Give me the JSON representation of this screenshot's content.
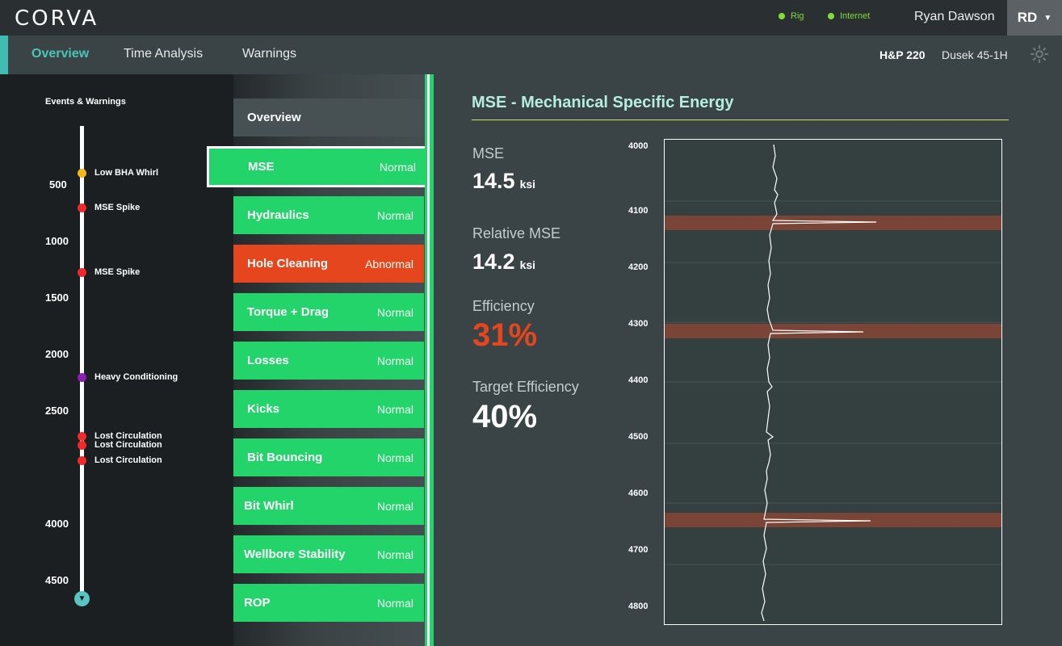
{
  "topbar": {
    "logo": "CORVA",
    "status": [
      {
        "label": "Rig",
        "color": "#7fdc3a"
      },
      {
        "label": "Internet",
        "color": "#7fdc3a"
      }
    ],
    "user_name": "Ryan Dawson",
    "avatar_initials": "RD"
  },
  "nav": {
    "tabs": [
      {
        "label": "Overview",
        "active": true
      },
      {
        "label": "Time Analysis",
        "active": false
      },
      {
        "label": "Warnings",
        "active": false
      }
    ],
    "rig": "H&P 220",
    "well": "Dusek 45-1H"
  },
  "events": {
    "title": "Events & Warnings",
    "depth_labels": [
      "500",
      "1000",
      "1500",
      "2000",
      "2500",
      "4000",
      "4500"
    ],
    "items": [
      {
        "label": "Low BHA Whirl",
        "color": "#f4b71e"
      },
      {
        "label": "MSE Spike",
        "color": "#ef2a2a"
      },
      {
        "label": "MSE Spike",
        "color": "#ef2a2a"
      },
      {
        "label": "Heavy Conditioning",
        "color": "#8b1fb0"
      },
      {
        "label": "Lost Circulation",
        "color": "#ef2a2a"
      },
      {
        "label": "Lost Circulation",
        "color": "#ef2a2a"
      },
      {
        "label": "Lost Circulation",
        "color": "#ef2a2a"
      }
    ]
  },
  "analysis_list": {
    "overview_label": "Overview",
    "items": [
      {
        "name": "MSE",
        "status": "Normal",
        "selected": true
      },
      {
        "name": "Hydraulics",
        "status": "Normal"
      },
      {
        "name": "Hole Cleaning",
        "status": "Abnormal"
      },
      {
        "name": "Torque + Drag",
        "status": "Normal"
      },
      {
        "name": "Losses",
        "status": "Normal"
      },
      {
        "name": "Kicks",
        "status": "Normal"
      },
      {
        "name": "Bit Bouncing",
        "status": "Normal"
      },
      {
        "name": "Bit Whirl",
        "status": "Normal"
      },
      {
        "name": "Wellbore Stability",
        "status": "Normal"
      },
      {
        "name": "ROP",
        "status": "Normal"
      }
    ]
  },
  "detail": {
    "title": "MSE - Mechanical Specific Energy",
    "metrics": [
      {
        "label": "MSE",
        "value": "14.5",
        "unit": "ksi"
      },
      {
        "label": "Relative MSE",
        "value": "14.2",
        "unit": "ksi"
      },
      {
        "label": "Efficiency",
        "value": "31%",
        "unit": ""
      },
      {
        "label": "Target Efficiency",
        "value": "40%",
        "unit": ""
      }
    ],
    "chart": {
      "y_ticks": [
        "4000",
        "4100",
        "4200",
        "4300",
        "4400",
        "4500",
        "4600",
        "4700",
        "4800"
      ],
      "ylim": [
        4000,
        4800
      ],
      "highlight_bands_depth": [
        4120,
        4312,
        4648
      ],
      "band_color": "#7a4536"
    }
  }
}
